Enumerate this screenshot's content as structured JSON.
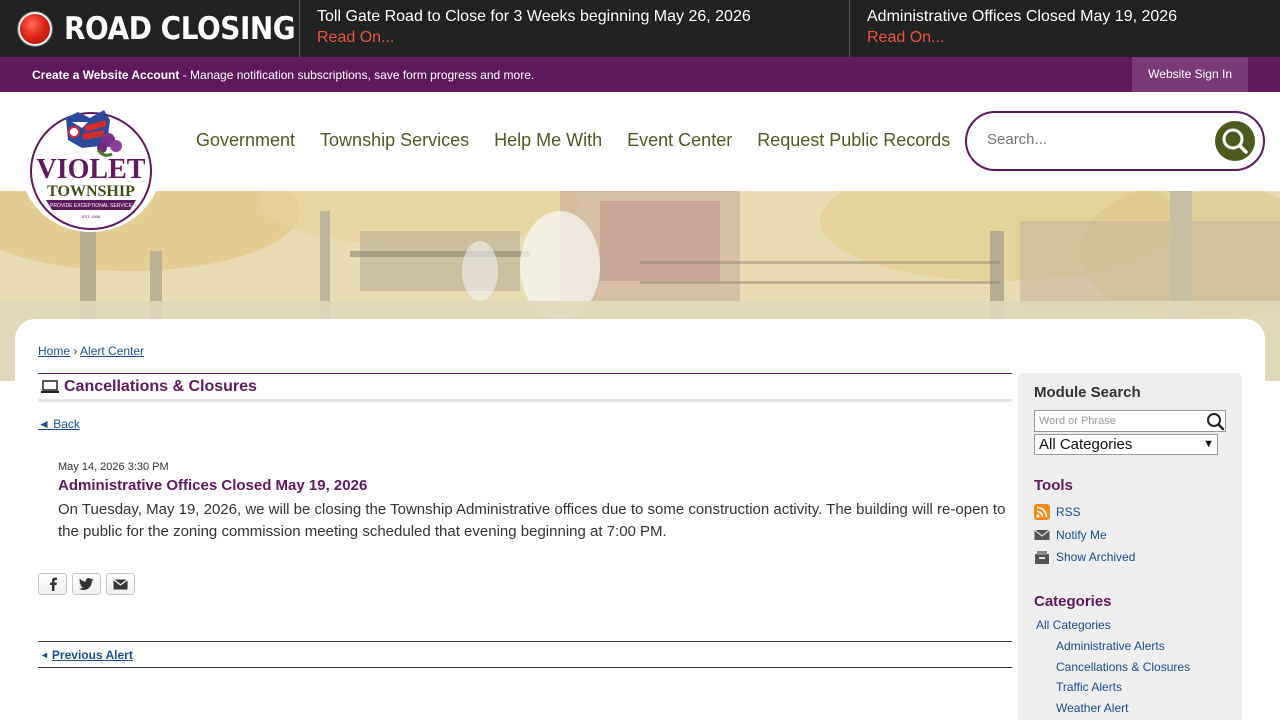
{
  "alert_bar": {
    "title": "ROAD CLOSING",
    "items": [
      {
        "title": "Toll Gate Road to Close for 3 Weeks beginning May 26, 2026",
        "link": "Read On..."
      },
      {
        "title": "Administrative Offices Closed May 19, 2026",
        "link": "Read On..."
      }
    ]
  },
  "account_bar": {
    "create_label": "Create a Website Account",
    "description": " - Manage notification subscriptions, save form progress and more.",
    "sign_in": "Website Sign In"
  },
  "logo": {
    "line1": "VIOLET",
    "line2": "TOWNSHIP",
    "tagline": "PROVIDE EXCEPTIONAL SERVICE",
    "est": "EST. 1808"
  },
  "nav": {
    "items": [
      "Government",
      "Township Services",
      "Help Me With",
      "Event Center",
      "Request Public Records"
    ]
  },
  "search": {
    "placeholder": "Search..."
  },
  "breadcrumb": {
    "home": "Home",
    "separator": "›",
    "current": "Alert Center"
  },
  "module": {
    "title": "Cancellations & Closures",
    "back": "◄ Back"
  },
  "alert": {
    "date": "May 14, 2026 3:30 PM",
    "heading": "Administrative Offices Closed May 19, 2026",
    "body": "On Tuesday, May 19, 2026, we will be closing the Township Administrative offices due to some construction activity. The building will re-open to the public for the zoning commission meeting scheduled that evening beginning at 7:00 PM."
  },
  "prev_alert": {
    "arrow": "◄",
    "label": "Previous Alert"
  },
  "sidebar": {
    "module_search": {
      "heading": "Module Search",
      "placeholder": "Word or Phrase",
      "category_selected": "All Categories"
    },
    "tools": {
      "heading": "Tools",
      "items": [
        "RSS",
        "Notify Me",
        "Show Archived"
      ]
    },
    "categories": {
      "heading": "Categories",
      "all": "All Categories",
      "items": [
        "Administrative Alerts",
        "Cancellations & Closures",
        "Traffic Alerts",
        "Weather Alert"
      ]
    }
  },
  "colors": {
    "brand_purple": "#5e1a5c",
    "nav_olive": "#4d5a1f",
    "alert_red": "#e8543e",
    "link_blue": "#1a4e8f"
  }
}
